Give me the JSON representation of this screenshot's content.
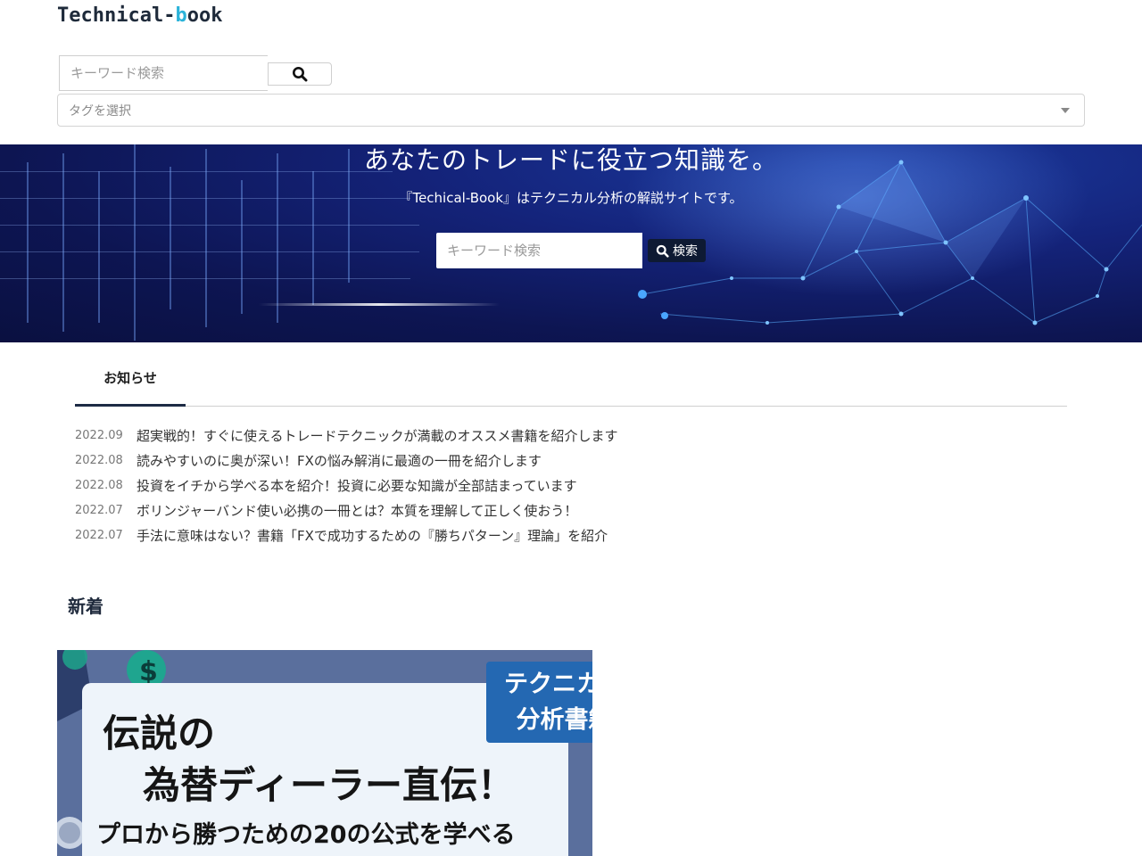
{
  "header": {
    "logo_main": "Technical-",
    "logo_accent": "b",
    "logo_tail": "ook",
    "search_placeholder": "キーワード検索",
    "tag_select_placeholder": "タグを選択"
  },
  "hero": {
    "title": "あなたのトレードに役立つ知識を。",
    "subtitle": "『Techical-Book』はテクニカル分析の解説サイトです。",
    "search_placeholder": "キーワード検索",
    "search_button_label": "検索"
  },
  "news": {
    "tab_label": "お知らせ",
    "items": [
      {
        "date": "2022.09",
        "title": "超実戦的！すぐに使えるトレードテクニックが満載のオススメ書籍を紹介します"
      },
      {
        "date": "2022.08",
        "title": "読みやすいのに奥が深い！FXの悩み解消に最適の一冊を紹介します"
      },
      {
        "date": "2022.08",
        "title": "投資をイチから学べる本を紹介！投資に必要な知識が全部詰まっています"
      },
      {
        "date": "2022.07",
        "title": "ボリンジャーバンド使い必携の一冊とは？本質を理解して正しく使おう！"
      },
      {
        "date": "2022.07",
        "title": "手法に意味はない？書籍「FXで成功するための『勝ちパターン』理論」を紹介"
      }
    ]
  },
  "new_section": {
    "heading": "新着"
  },
  "article_card": {
    "badge_line1": "テクニカル",
    "badge_line2": "分析書籍",
    "title_line1": "伝説の",
    "title_line2": "為替ディーラー直伝！",
    "title_line3": "プロから勝つための20の公式を学べる"
  },
  "colors": {
    "accent": "#2bb3d9",
    "hero_bg": "#14237a",
    "hero_button": "#0e1a33",
    "card_badge": "#2468b2"
  }
}
